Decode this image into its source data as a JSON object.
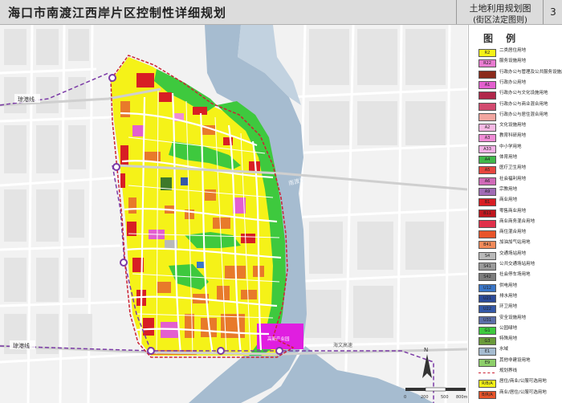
{
  "title": {
    "main": "海口市南渡江西岸片区控制性详细规划",
    "sheet_title": "土地利用规划图",
    "sheet_subtitle": "(街区法定图则)",
    "sheet_number": "3"
  },
  "map": {
    "road_labels": [
      "琼港线",
      "琼港线",
      "海文高速"
    ],
    "river_label": "南渡江",
    "bottom_label": "高新产业园",
    "north_arrow_label": "N",
    "scale": {
      "labels": [
        "0",
        "200",
        "500",
        "800m"
      ]
    }
  },
  "colors": {
    "residential": "#f5f218",
    "residential_alt": "#e8d83a",
    "green": "#3ec93e",
    "water": "#a6bcd0",
    "commercial": "#d81e24",
    "admin": "#e35fcf",
    "education": "#f08cd6",
    "mixed": "#e87a2a",
    "road": "#ffffff",
    "boundary": "#cc2233",
    "rail": "#7b3aa6"
  },
  "legend": {
    "title": "图 例",
    "items": [
      {
        "code": "R2",
        "label": "二类居住用地",
        "color": "#f5f218"
      },
      {
        "code": "R22",
        "label": "服务设施用地",
        "color": "#e87bd0"
      },
      {
        "code": "",
        "label": "行政办公与管理及公共服务设施用地",
        "color": "#8b2b1c"
      },
      {
        "code": "A1",
        "label": "行政办公用地",
        "color": "#e35fcf"
      },
      {
        "code": "",
        "label": "行政办公与文化设施用地",
        "color": "#b0274a"
      },
      {
        "code": "",
        "label": "行政办公与商业混合用地",
        "color": "#d24a6f"
      },
      {
        "code": "",
        "label": "行政办公与居住混合用地",
        "color": "#f2a6a0"
      },
      {
        "code": "A2",
        "label": "文化设施用地",
        "color": "#f5b8e3"
      },
      {
        "code": "A3",
        "label": "教育科研用地",
        "color": "#f08cd6"
      },
      {
        "code": "A33",
        "label": "中小学用地",
        "color": "#f3b0e6"
      },
      {
        "code": "A4",
        "label": "体育用地",
        "color": "#40b84a"
      },
      {
        "code": "A5",
        "label": "医疗卫生用地",
        "color": "#e7463f"
      },
      {
        "code": "A6",
        "label": "社会福利用地",
        "color": "#d06ab8"
      },
      {
        "code": "A9",
        "label": "宗教用地",
        "color": "#a06cb5"
      },
      {
        "code": "B1",
        "label": "商业用地",
        "color": "#d81e24"
      },
      {
        "code": "B11",
        "label": "零售商业用地",
        "color": "#c0161d"
      },
      {
        "code": "",
        "label": "商业商务混合用地",
        "color": "#e0304a"
      },
      {
        "code": "",
        "label": "商住混合用地",
        "color": "#e8542a"
      },
      {
        "code": "B41",
        "label": "加油加气站用地",
        "color": "#f28a5a"
      },
      {
        "code": "S4",
        "label": "交通场站用地",
        "color": "#b9b9b9"
      },
      {
        "code": "S41",
        "label": "公共交通场站用地",
        "color": "#9a9a9a"
      },
      {
        "code": "S42",
        "label": "社会停车场用地",
        "color": "#7d7d7d"
      },
      {
        "code": "U12",
        "label": "供电用地",
        "color": "#3a76c8"
      },
      {
        "code": "U21",
        "label": "排水用地",
        "color": "#2b4a99"
      },
      {
        "code": "U22",
        "label": "环卫用地",
        "color": "#3458a8"
      },
      {
        "code": "U31",
        "label": "安全设施用地",
        "color": "#5c6ea8"
      },
      {
        "code": "G1",
        "label": "公园绿地",
        "color": "#3ec93e"
      },
      {
        "code": "G3",
        "label": "特殊用地",
        "color": "#6a9a3a"
      },
      {
        "code": "E1",
        "label": "水域",
        "color": "#a6bcd0"
      },
      {
        "code": "E9",
        "label": "其他非建设用地",
        "color": "#8dcf6a"
      },
      {
        "code": "",
        "label": "规划界线",
        "color": "#cc2233"
      },
      {
        "code": "R/B/A",
        "label": "居住/商业/公服可选用地",
        "color": "#f5f218"
      },
      {
        "code": "B/R/A",
        "label": "商业/居住/公服可选用地",
        "color": "#e8542a"
      }
    ]
  }
}
